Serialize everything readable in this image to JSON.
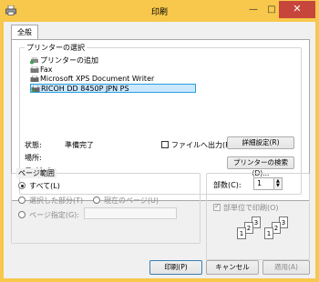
{
  "window": {
    "title": "印刷",
    "minimize_glyph": "—",
    "maximize_glyph": "□",
    "close_glyph": "✕"
  },
  "tabs": [
    {
      "label": "全般"
    }
  ],
  "printer_group": {
    "label": "プリンターの選択",
    "printers": [
      {
        "name": "プリンターの追加",
        "icon": "add-printer-icon"
      },
      {
        "name": "Fax",
        "icon": "fax-icon"
      },
      {
        "name": "Microsoft XPS Document Writer",
        "icon": "printer-icon"
      },
      {
        "name": "RICOH DD 8450P JPN PS",
        "icon": "printer-icon",
        "selected": true
      }
    ],
    "status_label": "状態:",
    "status_value": "準備完了",
    "location_label": "場所:",
    "location_value": "",
    "comment_label": "コメント:",
    "comment_value": "",
    "print_to_file_label": "ファイルへ出力(F)",
    "print_to_file_checked": false,
    "preferences_button": "詳細設定(R)",
    "find_printer_button": "プリンターの検索(D)..."
  },
  "page_range": {
    "label": "ページ範囲",
    "options": [
      {
        "label": "すべて(L)",
        "selected": true,
        "enabled": true
      },
      {
        "label": "選択した部分(T)",
        "selected": false,
        "enabled": false
      },
      {
        "label": "現在のページ(U)",
        "selected": false,
        "enabled": false
      },
      {
        "label": "ページ指定(G):",
        "selected": false,
        "enabled": false
      }
    ],
    "pages_input_value": ""
  },
  "copies": {
    "label": "部数(C):",
    "value": "1",
    "collate_label": "部単位で印刷(O)",
    "collate_checked": true,
    "collate_enabled": false,
    "collate_numbers": [
      "1",
      "2",
      "3"
    ]
  },
  "footer": {
    "print_button": "印刷(P)",
    "cancel_button": "キャンセル",
    "apply_button": "適用(A)"
  },
  "colors": {
    "title_bar": "#f7c84b",
    "close_button": "#c7463b",
    "selection_fill": "#cce8ff",
    "selection_border": "#26a0da"
  }
}
